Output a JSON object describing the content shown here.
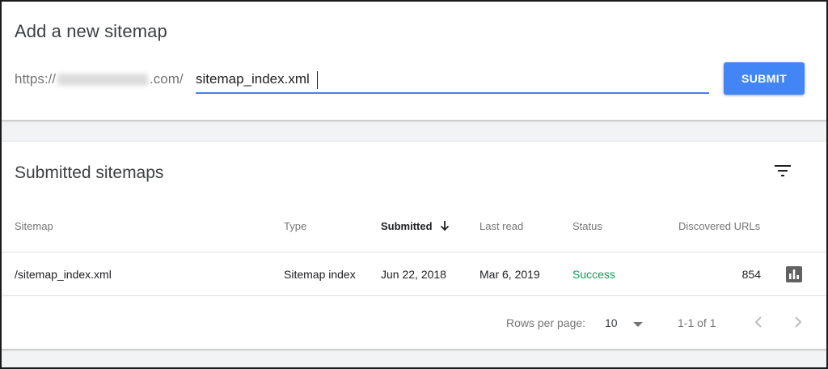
{
  "add_sitemap": {
    "title": "Add a new sitemap",
    "url_prefix_start": "https://",
    "url_prefix_end": ".com/",
    "input_value": "sitemap_index.xml",
    "submit_label": "SUBMIT"
  },
  "submitted": {
    "title": "Submitted sitemaps",
    "columns": {
      "sitemap": "Sitemap",
      "type": "Type",
      "submitted": "Submitted",
      "last_read": "Last read",
      "status": "Status",
      "discovered_urls": "Discovered URLs"
    },
    "rows": [
      {
        "sitemap": "/sitemap_index.xml",
        "type": "Sitemap index",
        "submitted": "Jun 22, 2018",
        "last_read": "Mar 6, 2019",
        "status": "Success",
        "discovered_urls": "854"
      }
    ],
    "footer": {
      "rows_per_page_label": "Rows per page:",
      "rows_per_page_value": "10",
      "range": "1-1 of 1"
    }
  },
  "colors": {
    "accent": "#4285f4",
    "success": "#0f9d58"
  },
  "icons": {
    "filter": "filter-icon",
    "sort": "arrow-down-icon",
    "report": "bar-chart-icon",
    "prev": "chevron-left-icon",
    "next": "chevron-right-icon",
    "dropdown": "dropdown-caret-icon"
  }
}
